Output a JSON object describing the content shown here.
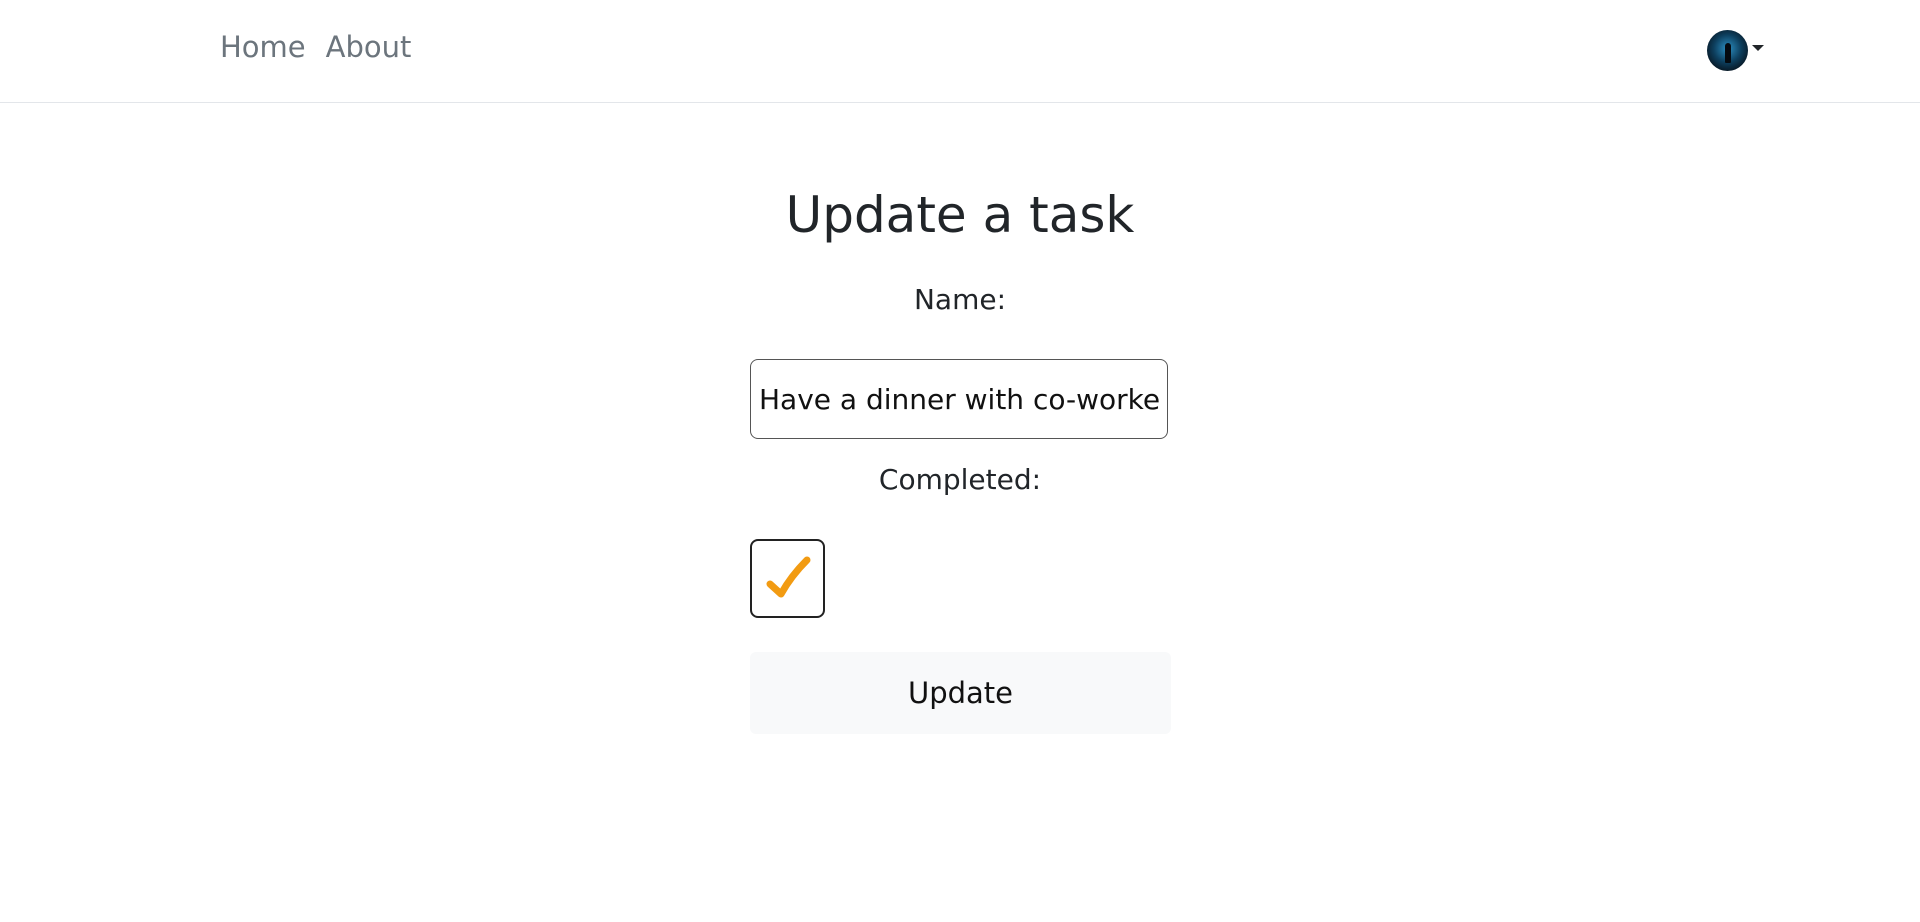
{
  "nav": {
    "links": [
      {
        "label": "Home"
      },
      {
        "label": "About"
      }
    ]
  },
  "user_menu": {
    "avatar_icon": "user-avatar-icon",
    "dropdown_icon": "caret-down-icon"
  },
  "form": {
    "title": "Update a task",
    "name_label": "Name:",
    "name_value": "Have a dinner with co-workers",
    "completed_label": "Completed:",
    "completed": true,
    "check_icon": "checkmark-icon",
    "check_color": "#f29b12",
    "submit_label": "Update"
  }
}
